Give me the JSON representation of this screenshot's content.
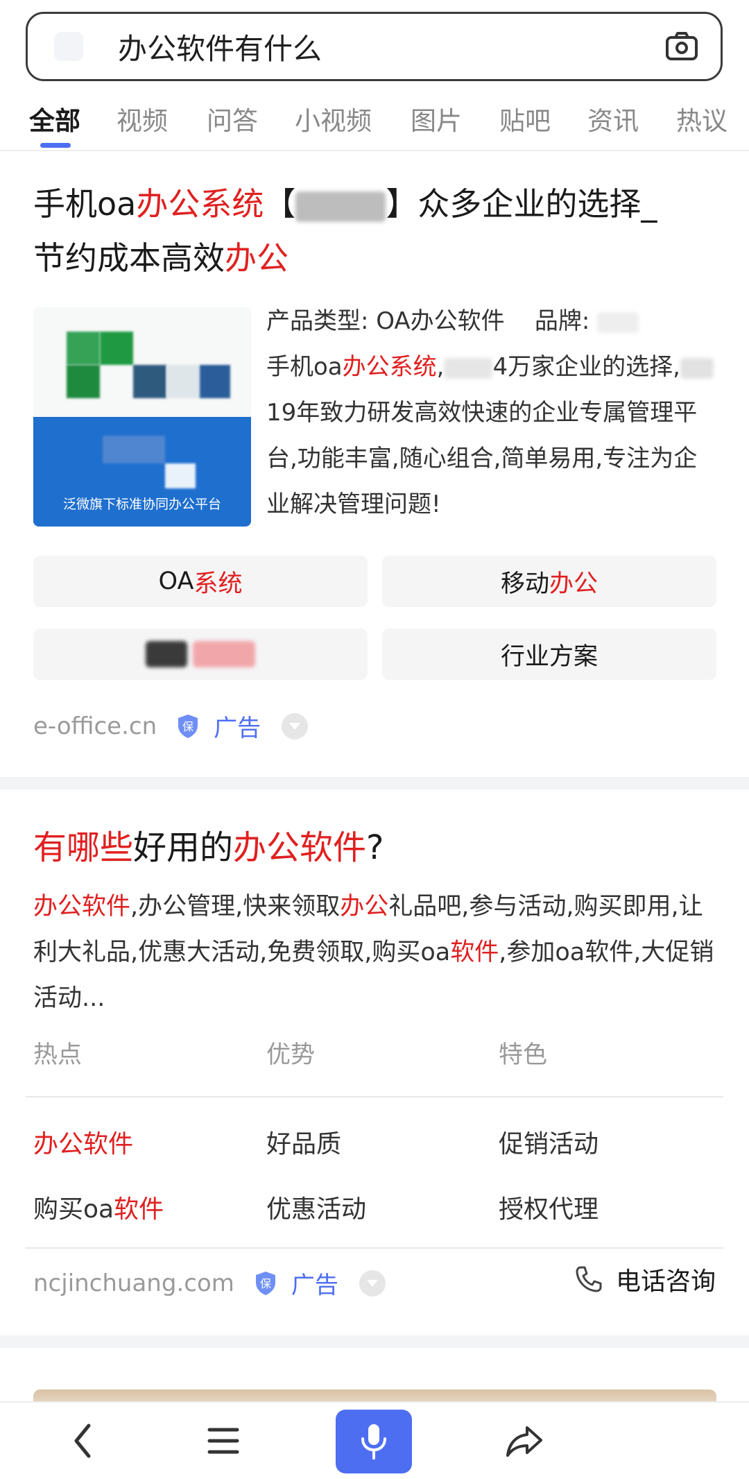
{
  "search": {
    "query": "办公软件有什么"
  },
  "tabs": [
    {
      "label": "全部"
    },
    {
      "label": "视频"
    },
    {
      "label": "问答"
    },
    {
      "label": "小视频"
    },
    {
      "label": "图片"
    },
    {
      "label": "贴吧"
    },
    {
      "label": "资讯"
    },
    {
      "label": "热议"
    }
  ],
  "result1": {
    "title_a": "手机oa",
    "title_b": "办公系统",
    "title_c": "【",
    "title_d": "】众多企业的选择_",
    "title_e": "节约成本高效",
    "title_f": "办公",
    "image_caption": "泛微旗下标准协同办公平台",
    "desc_1": "产品类型: OA办公软件",
    "desc_2": "品牌: ",
    "desc_3": "手机oa",
    "desc_4": "办公系统",
    "desc_5": ",",
    "desc_6": "4万家企业的选择,",
    "desc_7": "19年致力研发高效快速的企业专属管理平台,功能丰富,随心组合,简单易用,专注为企业解决管理问题!",
    "links": [
      {
        "a": "OA",
        "b": "系统"
      },
      {
        "a": "移动",
        "b": "办公"
      },
      {
        "a": "",
        "b": ""
      },
      {
        "a": "行业方案",
        "b": ""
      }
    ],
    "source": "e-office.cn",
    "ad_label": "广告"
  },
  "result2": {
    "title_a": "有哪些",
    "title_b": "好用的",
    "title_c": "办公软件",
    "title_d": "?",
    "desc_a": "办公软件",
    "desc_b": ",办公管理,快来领取",
    "desc_c": "办公",
    "desc_d": "礼品吧,参与活动,购买即用,让利大礼品,优惠大活动,免费领取,购买oa",
    "desc_e": "软件",
    "desc_f": ",参加oa软件,大促销活动...",
    "headers": [
      "热点",
      "优势",
      "特色"
    ],
    "rows": [
      {
        "c1a": "",
        "c1b": "办公软件",
        "c2": "好品质",
        "c3": "促销活动"
      },
      {
        "c1a": "购买oa",
        "c1b": "软件",
        "c2": "优惠活动",
        "c3": "授权代理"
      }
    ],
    "source": "ncjinchuang.com",
    "ad_label": "广告",
    "phone_label": "电话咨询"
  },
  "colors": {
    "accent": "#4e6ef2",
    "highlight": "#e02020"
  }
}
